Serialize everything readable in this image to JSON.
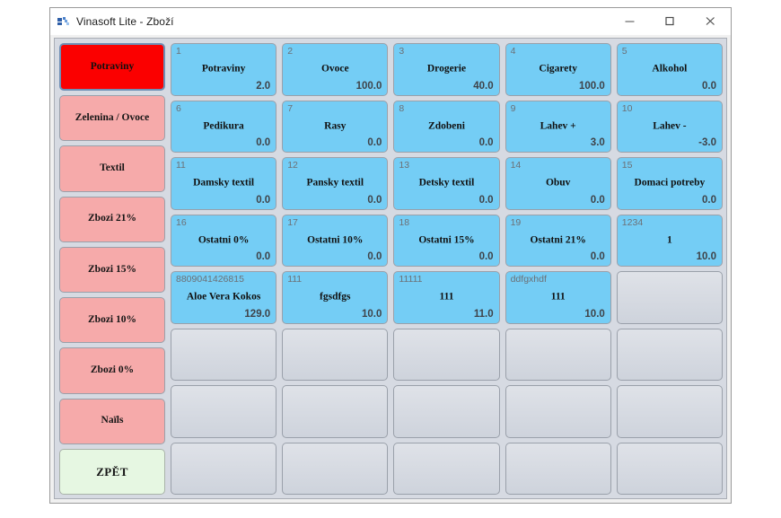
{
  "window": {
    "title": "Vinasoft Lite - Zboží",
    "app_icon": "app-icon",
    "controls": {
      "minimize": "minimize-icon",
      "maximize": "maximize-icon",
      "close": "close-icon"
    }
  },
  "colors": {
    "selected_category": "#fb0000",
    "category": "#f6aaaa",
    "back_button": "#e6f7e2",
    "tile_filled": "#74cdf5",
    "tile_empty": "#d6dae2",
    "panel_background": "#d6dae2"
  },
  "categories": [
    {
      "label": "Potraviny",
      "selected": true
    },
    {
      "label": "Zelenina / Ovoce",
      "selected": false
    },
    {
      "label": "Textil",
      "selected": false
    },
    {
      "label": "Zbozi 21%",
      "selected": false
    },
    {
      "label": "Zbozi 15%",
      "selected": false
    },
    {
      "label": "Zbozi 10%",
      "selected": false
    },
    {
      "label": "Zbozi 0%",
      "selected": false
    },
    {
      "label": "Naïls",
      "selected": false
    }
  ],
  "back_button": {
    "label": "ZPĚT"
  },
  "grid": {
    "columns": 5,
    "rows": 8,
    "tiles": [
      {
        "code": "1",
        "name": "Potraviny",
        "qty": "2.0",
        "empty": false
      },
      {
        "code": "2",
        "name": "Ovoce",
        "qty": "100.0",
        "empty": false
      },
      {
        "code": "3",
        "name": "Drogerie",
        "qty": "40.0",
        "empty": false
      },
      {
        "code": "4",
        "name": "Cigarety",
        "qty": "100.0",
        "empty": false
      },
      {
        "code": "5",
        "name": "Alkohol",
        "qty": "0.0",
        "empty": false
      },
      {
        "code": "6",
        "name": "Pedikura",
        "qty": "0.0",
        "empty": false
      },
      {
        "code": "7",
        "name": "Rasy",
        "qty": "0.0",
        "empty": false
      },
      {
        "code": "8",
        "name": "Zdobeni",
        "qty": "0.0",
        "empty": false
      },
      {
        "code": "9",
        "name": "Lahev +",
        "qty": "3.0",
        "empty": false
      },
      {
        "code": "10",
        "name": "Lahev -",
        "qty": "-3.0",
        "empty": false
      },
      {
        "code": "11",
        "name": "Damsky textil",
        "qty": "0.0",
        "empty": false
      },
      {
        "code": "12",
        "name": "Pansky textil",
        "qty": "0.0",
        "empty": false
      },
      {
        "code": "13",
        "name": "Detsky textil",
        "qty": "0.0",
        "empty": false
      },
      {
        "code": "14",
        "name": "Obuv",
        "qty": "0.0",
        "empty": false
      },
      {
        "code": "15",
        "name": "Domaci potreby",
        "qty": "0.0",
        "empty": false
      },
      {
        "code": "16",
        "name": "Ostatni 0%",
        "qty": "0.0",
        "empty": false
      },
      {
        "code": "17",
        "name": "Ostatni 10%",
        "qty": "0.0",
        "empty": false
      },
      {
        "code": "18",
        "name": "Ostatni 15%",
        "qty": "0.0",
        "empty": false
      },
      {
        "code": "19",
        "name": "Ostatni 21%",
        "qty": "0.0",
        "empty": false
      },
      {
        "code": "1234",
        "name": "1",
        "qty": "10.0",
        "empty": false
      },
      {
        "code": "8809041426815",
        "name": "Aloe Vera Kokos",
        "qty": "129.0",
        "empty": false
      },
      {
        "code": "111",
        "name": "fgsdfgs",
        "qty": "10.0",
        "empty": false
      },
      {
        "code": "11111",
        "name": "111",
        "qty": "11.0",
        "empty": false
      },
      {
        "code": "ddfgxhdf",
        "name": "111",
        "qty": "10.0",
        "empty": false
      },
      {
        "code": "",
        "name": "",
        "qty": "",
        "empty": true
      },
      {
        "code": "",
        "name": "",
        "qty": "",
        "empty": true
      },
      {
        "code": "",
        "name": "",
        "qty": "",
        "empty": true
      },
      {
        "code": "",
        "name": "",
        "qty": "",
        "empty": true
      },
      {
        "code": "",
        "name": "",
        "qty": "",
        "empty": true
      },
      {
        "code": "",
        "name": "",
        "qty": "",
        "empty": true
      },
      {
        "code": "",
        "name": "",
        "qty": "",
        "empty": true
      },
      {
        "code": "",
        "name": "",
        "qty": "",
        "empty": true
      },
      {
        "code": "",
        "name": "",
        "qty": "",
        "empty": true
      },
      {
        "code": "",
        "name": "",
        "qty": "",
        "empty": true
      },
      {
        "code": "",
        "name": "",
        "qty": "",
        "empty": true
      },
      {
        "code": "",
        "name": "",
        "qty": "",
        "empty": true
      },
      {
        "code": "",
        "name": "",
        "qty": "",
        "empty": true
      },
      {
        "code": "",
        "name": "",
        "qty": "",
        "empty": true
      },
      {
        "code": "",
        "name": "",
        "qty": "",
        "empty": true
      },
      {
        "code": "",
        "name": "",
        "qty": "",
        "empty": true
      }
    ]
  }
}
